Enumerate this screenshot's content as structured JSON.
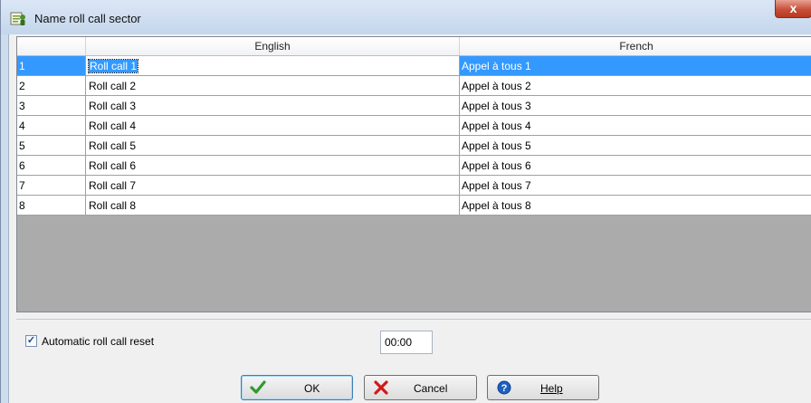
{
  "window": {
    "title": "Name roll call sector",
    "close_glyph": "x"
  },
  "table": {
    "columns": [
      "",
      "English",
      "French"
    ],
    "rows": [
      {
        "num": "1",
        "english": "Roll call 1",
        "french": "Appel à tous 1",
        "selected": true
      },
      {
        "num": "2",
        "english": "Roll call 2",
        "french": "Appel à tous 2"
      },
      {
        "num": "3",
        "english": "Roll call 3",
        "french": "Appel à tous 3"
      },
      {
        "num": "4",
        "english": "Roll call 4",
        "french": "Appel à tous 4"
      },
      {
        "num": "5",
        "english": "Roll call 5",
        "french": "Appel à tous 5"
      },
      {
        "num": "6",
        "english": "Roll call 6",
        "french": "Appel à tous 6"
      },
      {
        "num": "7",
        "english": "Roll call 7",
        "french": "Appel à tous 7"
      },
      {
        "num": "8",
        "english": "Roll call 8",
        "french": "Appel à tous 8"
      }
    ]
  },
  "options": {
    "auto_reset_label": "Automatic roll call reset",
    "auto_reset_checked": true,
    "reset_time": "00:00"
  },
  "buttons": {
    "ok": "OK",
    "cancel": "Cancel",
    "help": "Help"
  },
  "colors": {
    "selection": "#3399ff",
    "ok_icon": "#2e9a2e",
    "cancel_icon": "#d11919",
    "help_icon": "#1f5fbf"
  }
}
